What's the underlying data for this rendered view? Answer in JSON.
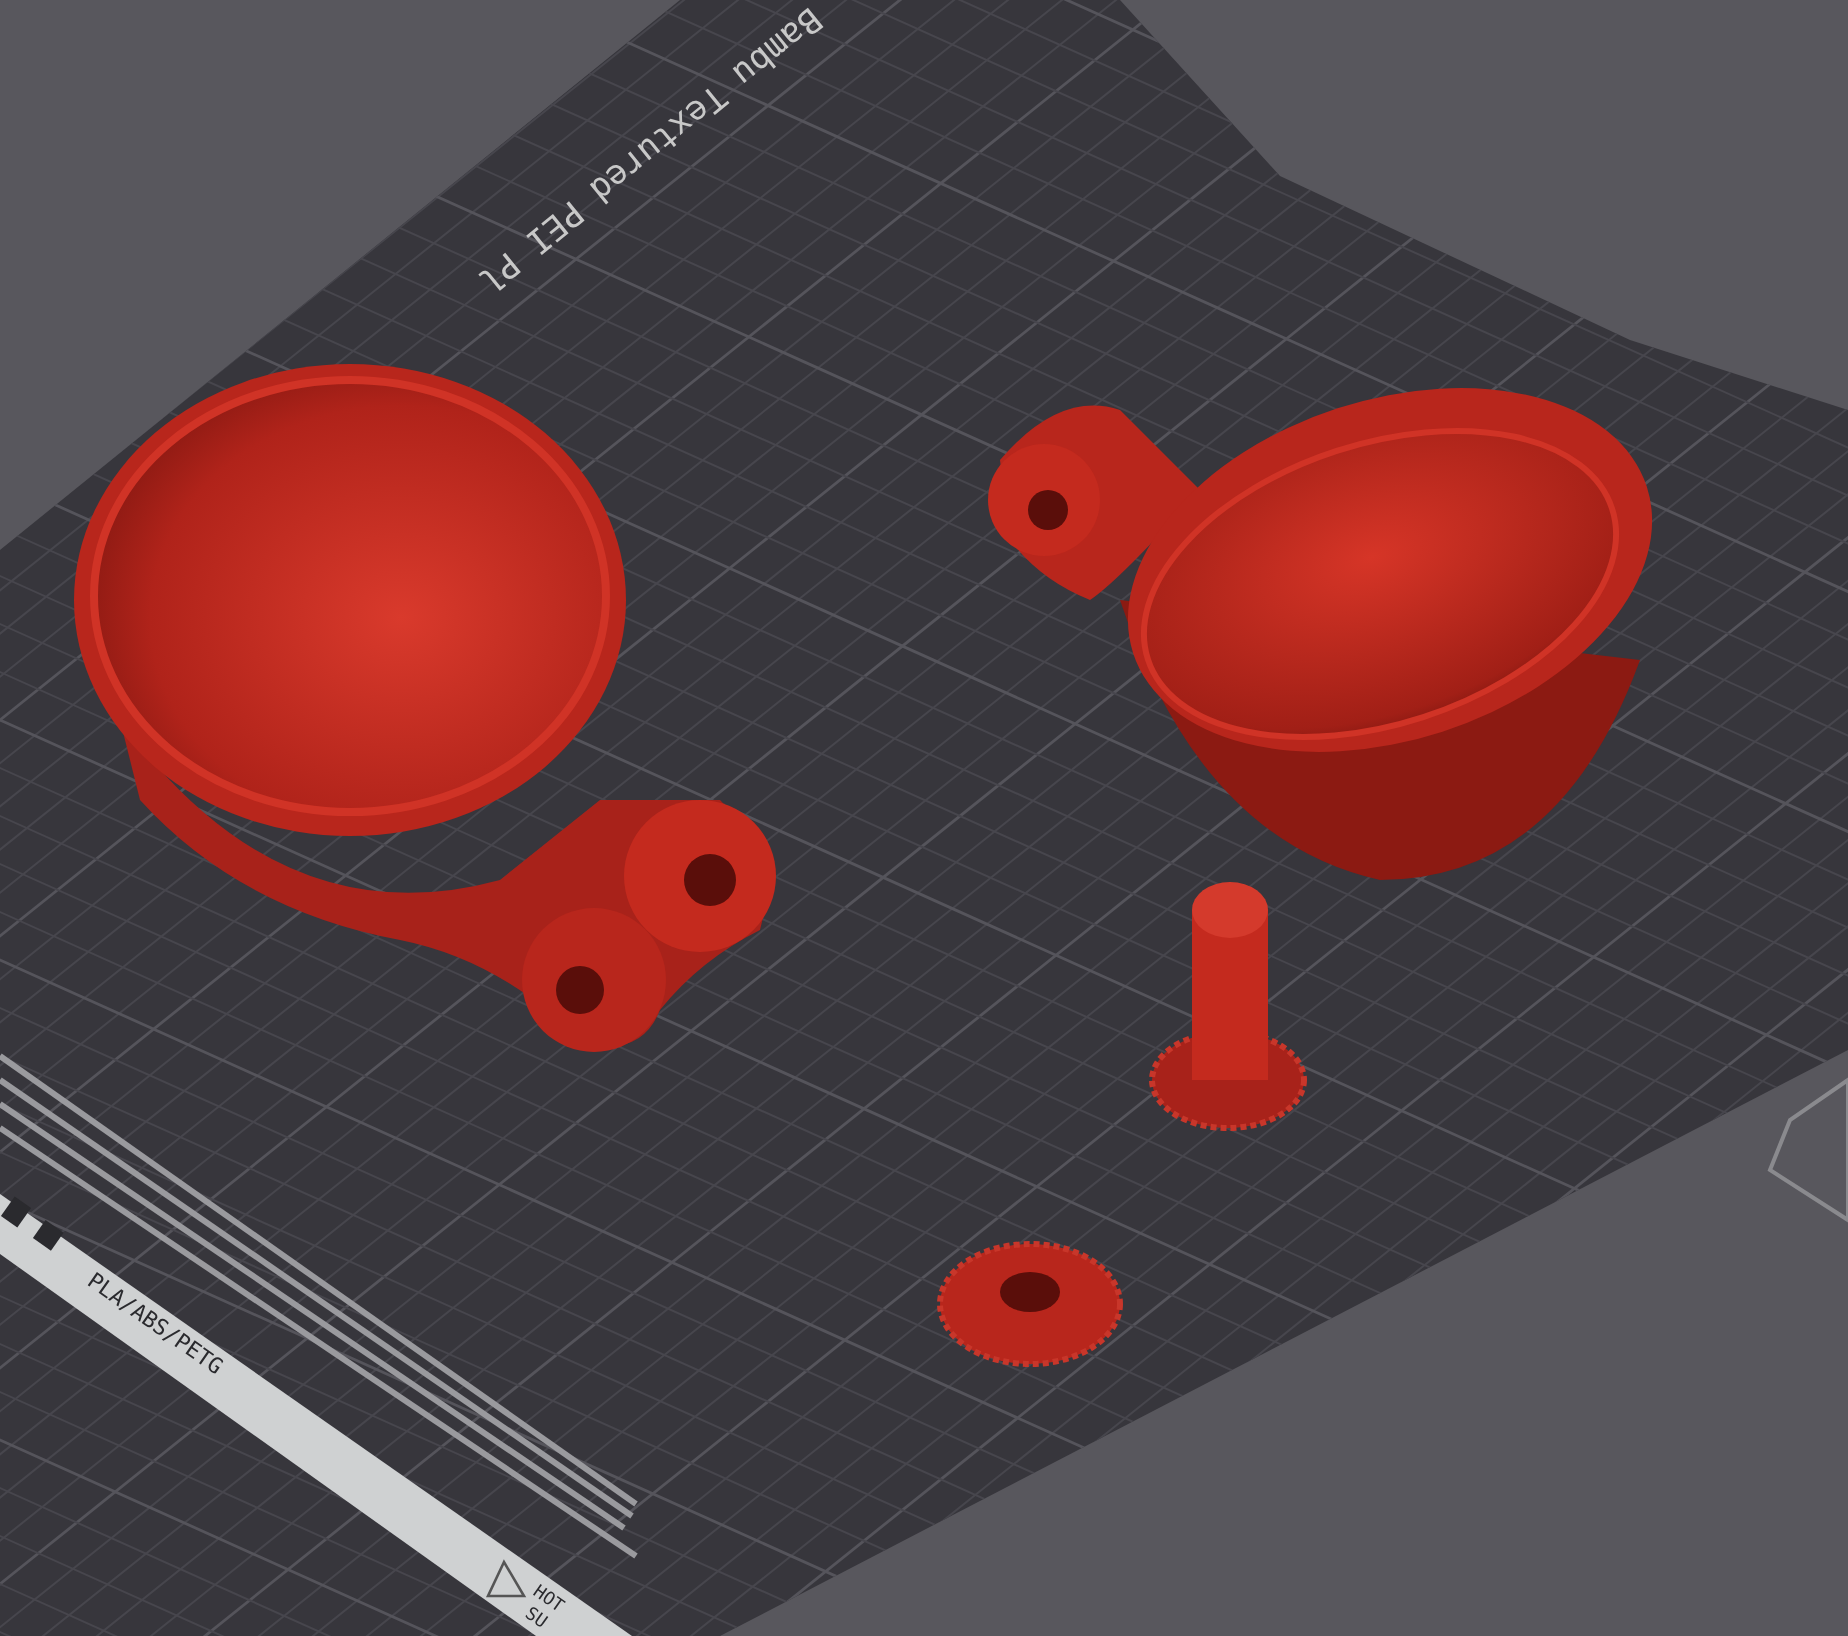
{
  "viewport": {
    "plate_label": "Bambu Textured PEI Pl",
    "material_label": "PLA/ABS/PETG",
    "warning_label": "HOT",
    "warning_label_2": "SU"
  }
}
